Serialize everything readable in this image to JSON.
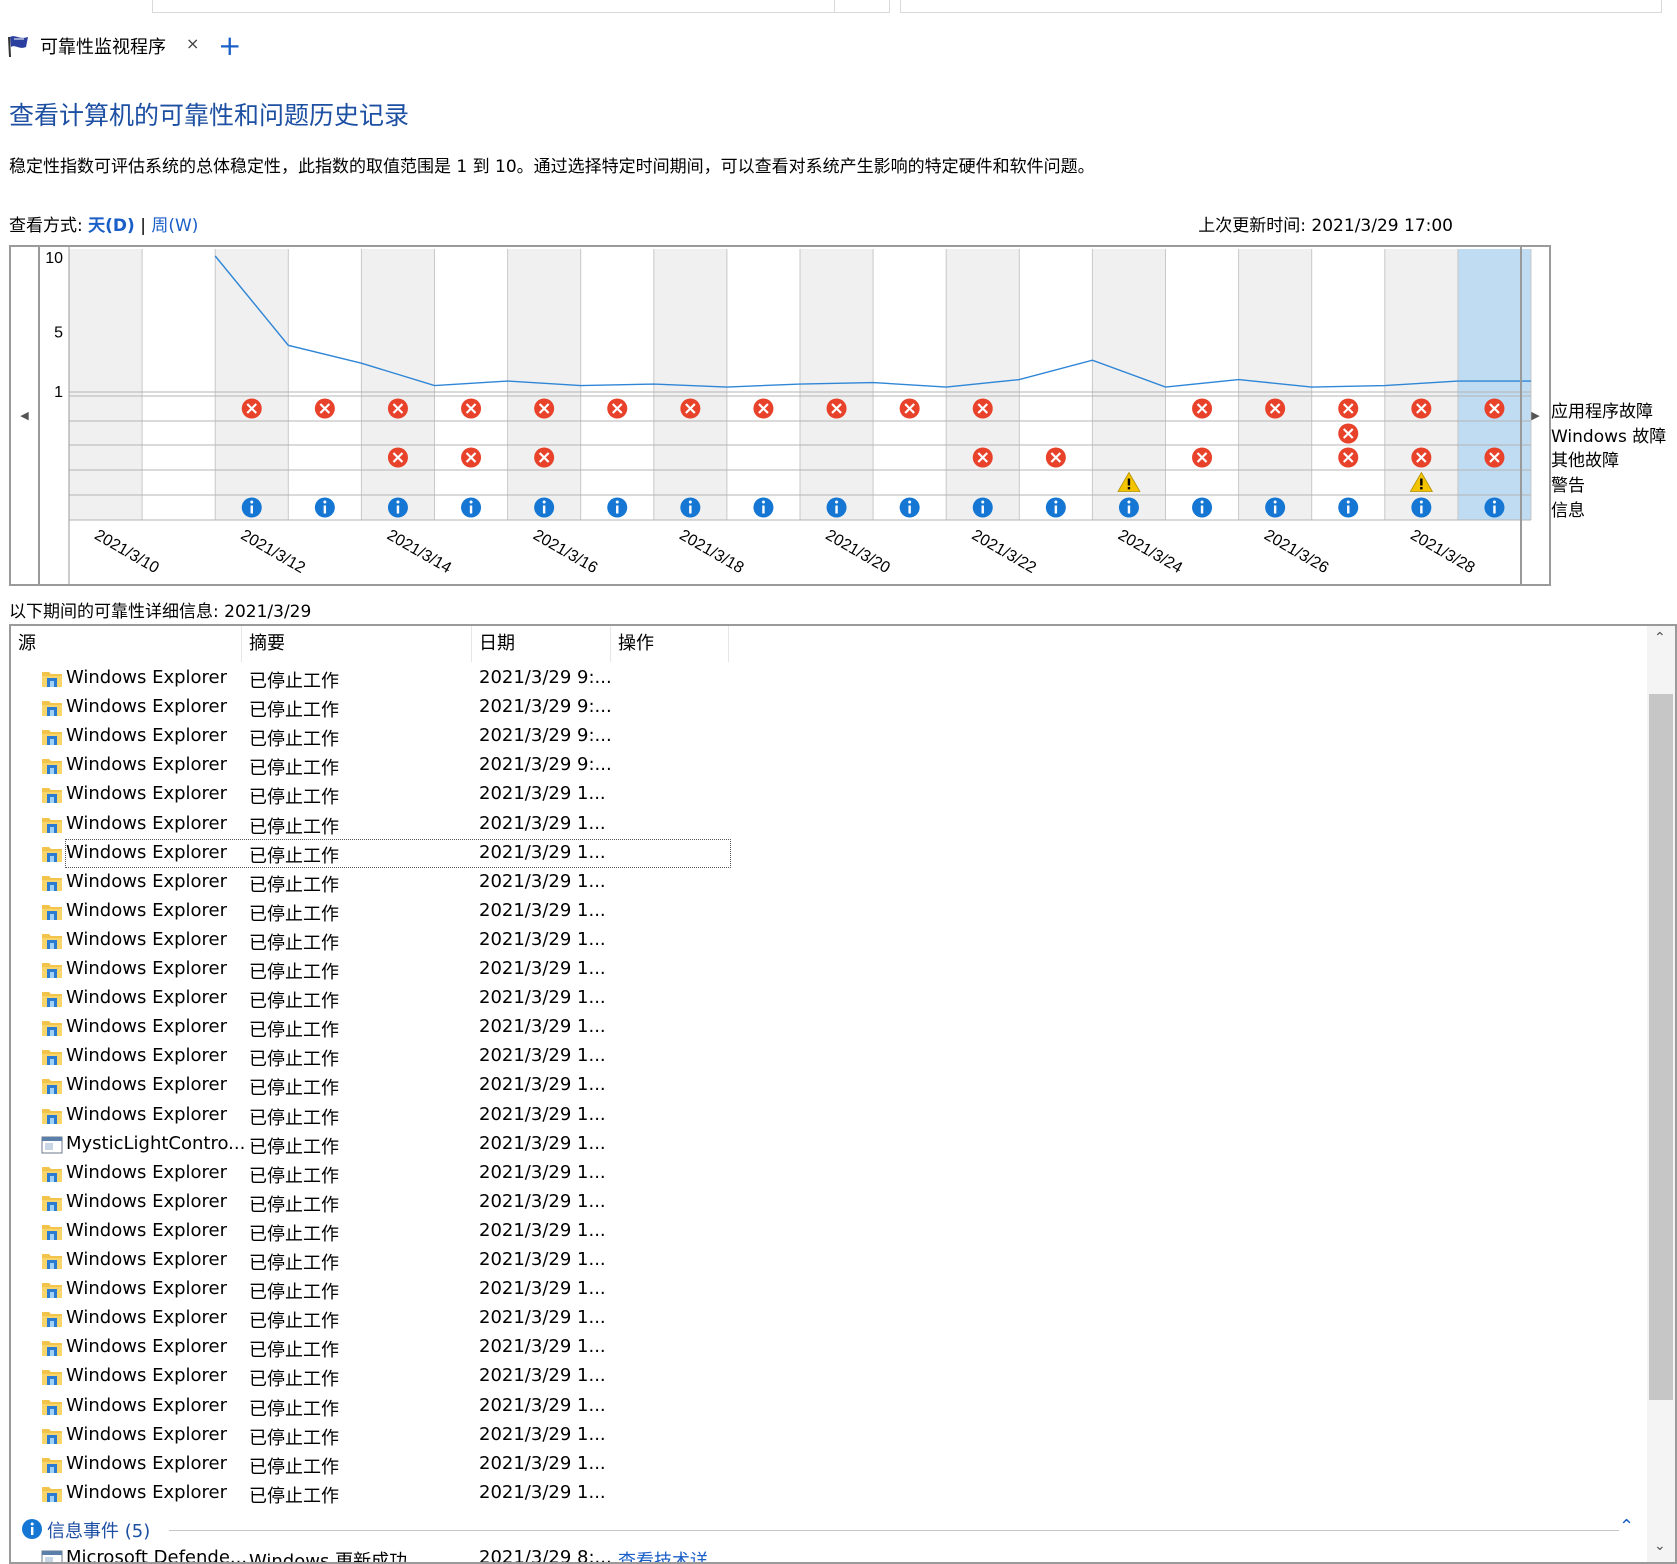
{
  "tab": {
    "title": "可靠性监视程序",
    "close": "×",
    "new_tab": "+"
  },
  "heading": "查看计算机的可靠性和问题历史记录",
  "description": "稳定性指数可评估系统的总体稳定性，此指数的取值范围是 1 到 10。通过选择特定时间期间，可以查看对系统产生影响的特定硬件和软件问题。",
  "view_mode": {
    "label": "查看方式:",
    "day": "天(D)",
    "separator": "|",
    "week": "周(W)"
  },
  "last_updated": "上次更新时间: 2021/3/29 17:00",
  "chart_data": {
    "type": "line",
    "title": "",
    "y_ticks": [
      "10",
      "5",
      "1"
    ],
    "ylim": [
      1,
      10
    ],
    "x_tick_labels": [
      "2021/3/10",
      "2021/3/12",
      "2021/3/14",
      "2021/3/16",
      "2021/3/18",
      "2021/3/20",
      "2021/3/22",
      "2021/3/24",
      "2021/3/26",
      "2021/3/28"
    ],
    "days": [
      "3/10",
      "3/11",
      "3/12",
      "3/13",
      "3/14",
      "3/15",
      "3/16",
      "3/17",
      "3/18",
      "3/19",
      "3/20",
      "3/21",
      "3/22",
      "3/23",
      "3/24",
      "3/25",
      "3/26",
      "3/27",
      "3/28",
      "3/29"
    ],
    "selected_day": "3/29",
    "series": [
      {
        "values": [
          null,
          null,
          10.0,
          4.0,
          2.8,
          1.3,
          1.6,
          1.3,
          1.4,
          1.2,
          1.4,
          1.5,
          1.2,
          1.7,
          3.0,
          1.2,
          1.7,
          1.2,
          1.3,
          1.6
        ]
      }
    ],
    "event_rows": [
      "应用程序故障",
      "Windows 故障",
      "其他故障",
      "警告",
      "信息"
    ],
    "events": {
      "应用程序故障": [
        "3/12",
        "3/13",
        "3/14",
        "3/15",
        "3/16",
        "3/17",
        "3/18",
        "3/19",
        "3/20",
        "3/21",
        "3/22",
        "3/25",
        "3/26",
        "3/27",
        "3/28",
        "3/29"
      ],
      "Windows 故障": [
        "3/27"
      ],
      "其他故障": [
        "3/14",
        "3/15",
        "3/16",
        "3/22",
        "3/23",
        "3/25",
        "3/27",
        "3/28",
        "3/29"
      ],
      "警告": [
        "3/24",
        "3/28"
      ],
      "信息": [
        "3/12",
        "3/13",
        "3/14",
        "3/15",
        "3/16",
        "3/17",
        "3/18",
        "3/19",
        "3/20",
        "3/21",
        "3/22",
        "3/23",
        "3/24",
        "3/25",
        "3/26",
        "3/27",
        "3/28",
        "3/29"
      ]
    }
  },
  "details_header": "以下期间的可靠性详细信息: 2021/3/29",
  "columns": [
    "源",
    "摘要",
    "日期",
    "操作"
  ],
  "sort_indicator": "^",
  "rows": [
    {
      "source": "Windows Explorer",
      "summary": "已停止工作",
      "date": "2021/3/29 9:...",
      "icon": "explorer-icon"
    },
    {
      "source": "Windows Explorer",
      "summary": "已停止工作",
      "date": "2021/3/29 9:...",
      "icon": "explorer-icon"
    },
    {
      "source": "Windows Explorer",
      "summary": "已停止工作",
      "date": "2021/3/29 9:...",
      "icon": "explorer-icon"
    },
    {
      "source": "Windows Explorer",
      "summary": "已停止工作",
      "date": "2021/3/29 9:...",
      "icon": "explorer-icon"
    },
    {
      "source": "Windows Explorer",
      "summary": "已停止工作",
      "date": "2021/3/29 1...",
      "icon": "explorer-icon"
    },
    {
      "source": "Windows Explorer",
      "summary": "已停止工作",
      "date": "2021/3/29 1...",
      "icon": "explorer-icon"
    },
    {
      "source": "Windows Explorer",
      "summary": "已停止工作",
      "date": "2021/3/29 1...",
      "icon": "explorer-icon",
      "selected": true
    },
    {
      "source": "Windows Explorer",
      "summary": "已停止工作",
      "date": "2021/3/29 1...",
      "icon": "explorer-icon"
    },
    {
      "source": "Windows Explorer",
      "summary": "已停止工作",
      "date": "2021/3/29 1...",
      "icon": "explorer-icon"
    },
    {
      "source": "Windows Explorer",
      "summary": "已停止工作",
      "date": "2021/3/29 1...",
      "icon": "explorer-icon"
    },
    {
      "source": "Windows Explorer",
      "summary": "已停止工作",
      "date": "2021/3/29 1...",
      "icon": "explorer-icon"
    },
    {
      "source": "Windows Explorer",
      "summary": "已停止工作",
      "date": "2021/3/29 1...",
      "icon": "explorer-icon"
    },
    {
      "source": "Windows Explorer",
      "summary": "已停止工作",
      "date": "2021/3/29 1...",
      "icon": "explorer-icon"
    },
    {
      "source": "Windows Explorer",
      "summary": "已停止工作",
      "date": "2021/3/29 1...",
      "icon": "explorer-icon"
    },
    {
      "source": "Windows Explorer",
      "summary": "已停止工作",
      "date": "2021/3/29 1...",
      "icon": "explorer-icon"
    },
    {
      "source": "Windows Explorer",
      "summary": "已停止工作",
      "date": "2021/3/29 1...",
      "icon": "explorer-icon"
    },
    {
      "source": "MysticLightContro...",
      "summary": "已停止工作",
      "date": "2021/3/29 1...",
      "icon": "app-window-icon"
    },
    {
      "source": "Windows Explorer",
      "summary": "已停止工作",
      "date": "2021/3/29 1...",
      "icon": "explorer-icon"
    },
    {
      "source": "Windows Explorer",
      "summary": "已停止工作",
      "date": "2021/3/29 1...",
      "icon": "explorer-icon"
    },
    {
      "source": "Windows Explorer",
      "summary": "已停止工作",
      "date": "2021/3/29 1...",
      "icon": "explorer-icon"
    },
    {
      "source": "Windows Explorer",
      "summary": "已停止工作",
      "date": "2021/3/29 1...",
      "icon": "explorer-icon"
    },
    {
      "source": "Windows Explorer",
      "summary": "已停止工作",
      "date": "2021/3/29 1...",
      "icon": "explorer-icon"
    },
    {
      "source": "Windows Explorer",
      "summary": "已停止工作",
      "date": "2021/3/29 1...",
      "icon": "explorer-icon"
    },
    {
      "source": "Windows Explorer",
      "summary": "已停止工作",
      "date": "2021/3/29 1...",
      "icon": "explorer-icon"
    },
    {
      "source": "Windows Explorer",
      "summary": "已停止工作",
      "date": "2021/3/29 1...",
      "icon": "explorer-icon"
    },
    {
      "source": "Windows Explorer",
      "summary": "已停止工作",
      "date": "2021/3/29 1...",
      "icon": "explorer-icon"
    },
    {
      "source": "Windows Explorer",
      "summary": "已停止工作",
      "date": "2021/3/29 1...",
      "icon": "explorer-icon"
    },
    {
      "source": "Windows Explorer",
      "summary": "已停止工作",
      "date": "2021/3/29 1...",
      "icon": "explorer-icon"
    },
    {
      "source": "Windows Explorer",
      "summary": "已停止工作",
      "date": "2021/3/29 1...",
      "icon": "explorer-icon"
    }
  ],
  "info_group": {
    "label": "信息事件 (5)"
  },
  "info_rows": [
    {
      "source": "Microsoft Defende...",
      "summary": "Windows 更新成功",
      "date": "2021/3/29 8:...",
      "action": "查看技术详...",
      "icon": "app-window-icon"
    }
  ],
  "colors": {
    "accent": "#1a5fc8",
    "heading": "#1d4fa3",
    "error": "#e8422b",
    "warning": "#f5c400",
    "info": "#1577d3",
    "line": "#2f86d6",
    "selected_day": "#bfdcf3"
  }
}
